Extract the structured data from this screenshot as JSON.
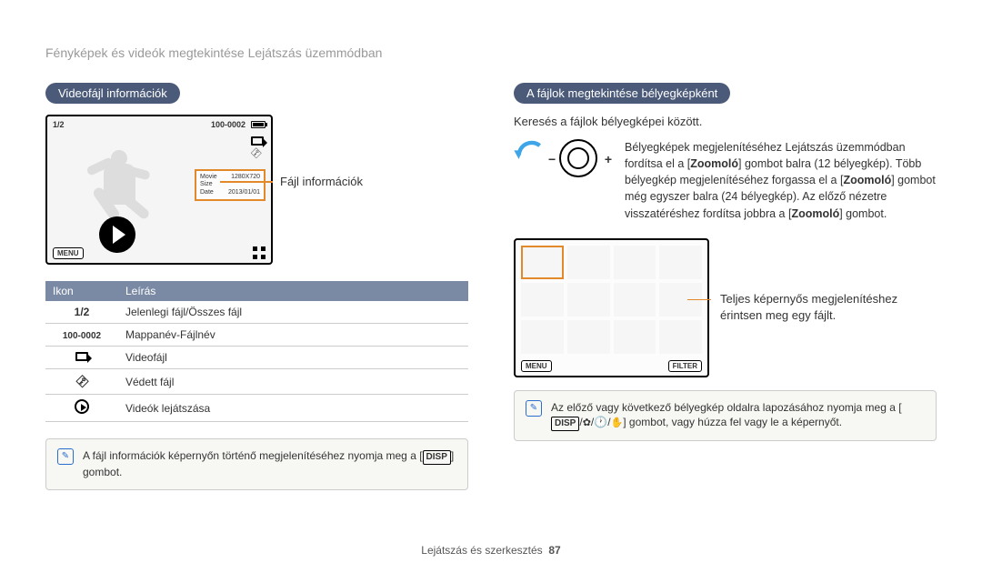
{
  "breadcrumb": "Fényképek és videók megtekintése Lejátszás üzemmódban",
  "left": {
    "heading": "Videofájl információk",
    "screen": {
      "top_left": "1/2",
      "top_right_id": "100-0002",
      "info_rows": [
        {
          "k": "Movie Size",
          "v": "1280X720"
        },
        {
          "k": "Date",
          "v": "2013/01/01"
        }
      ],
      "menu": "MENU"
    },
    "callout": "Fájl információk",
    "table": {
      "col1": "Ikon",
      "col2": "Leírás",
      "rows": [
        {
          "icon": "1/2",
          "type": "text",
          "desc": "Jelenlegi fájl/Összes fájl"
        },
        {
          "icon": "100-0002",
          "type": "text",
          "desc": "Mappanév-Fájlnév"
        },
        {
          "icon": "camera",
          "type": "camera",
          "desc": "Videofájl"
        },
        {
          "icon": "key",
          "type": "key",
          "desc": "Védett fájl"
        },
        {
          "icon": "play",
          "type": "play",
          "desc": "Videók lejátszása"
        }
      ]
    },
    "note": {
      "text1": "A fájl információk képernyőn történő megjelenítéséhez nyomja meg a",
      "disp": "DISP",
      "text2": "gombot."
    }
  },
  "right": {
    "heading": "A fájlok megtekintése bélyegképként",
    "subtitle": "Keresés a fájlok bélyegképei között.",
    "zoom": {
      "p1": "Bélyegképek megjelenítéséhez Lejátszás üzemmódban fordítsa el a [",
      "z1": "Zoomoló",
      "p2": "] gombot balra (12 bélyegkép). Több bélyegkép megjelenítéséhez forgassa el a [",
      "z2": "Zoomoló",
      "p3": "] gombot még egyszer balra (24 bélyegkép). Az előző nézetre visszatéréshez fordítsa jobbra a [",
      "z3": "Zoomoló",
      "p4": "] gombot."
    },
    "thumb_screen": {
      "menu": "MENU",
      "filter": "FILTER"
    },
    "thumb_callout": {
      "l1": "Teljes képernyős megjelenítéshez",
      "l2": "érintsen meg egy fájlt."
    },
    "note": {
      "text1": "Az előző vagy következő bélyegkép oldalra lapozásához nyomja meg a",
      "disp": "DISP",
      "text2": "gombot, vagy húzza fel vagy le a képernyőt."
    }
  },
  "footer": {
    "section": "Lejátszás és szerkesztés",
    "page": "87"
  }
}
